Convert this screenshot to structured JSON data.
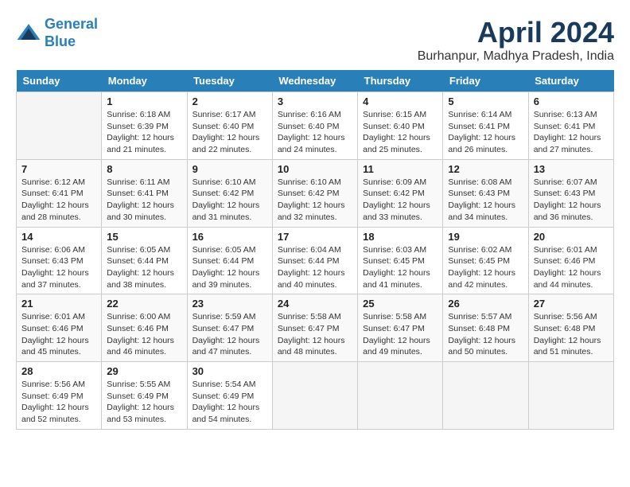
{
  "header": {
    "logo_line1": "General",
    "logo_line2": "Blue",
    "month": "April 2024",
    "location": "Burhanpur, Madhya Pradesh, India"
  },
  "weekdays": [
    "Sunday",
    "Monday",
    "Tuesday",
    "Wednesday",
    "Thursday",
    "Friday",
    "Saturday"
  ],
  "weeks": [
    [
      {
        "day": "",
        "info": ""
      },
      {
        "day": "1",
        "info": "Sunrise: 6:18 AM\nSunset: 6:39 PM\nDaylight: 12 hours\nand 21 minutes."
      },
      {
        "day": "2",
        "info": "Sunrise: 6:17 AM\nSunset: 6:40 PM\nDaylight: 12 hours\nand 22 minutes."
      },
      {
        "day": "3",
        "info": "Sunrise: 6:16 AM\nSunset: 6:40 PM\nDaylight: 12 hours\nand 24 minutes."
      },
      {
        "day": "4",
        "info": "Sunrise: 6:15 AM\nSunset: 6:40 PM\nDaylight: 12 hours\nand 25 minutes."
      },
      {
        "day": "5",
        "info": "Sunrise: 6:14 AM\nSunset: 6:41 PM\nDaylight: 12 hours\nand 26 minutes."
      },
      {
        "day": "6",
        "info": "Sunrise: 6:13 AM\nSunset: 6:41 PM\nDaylight: 12 hours\nand 27 minutes."
      }
    ],
    [
      {
        "day": "7",
        "info": "Sunrise: 6:12 AM\nSunset: 6:41 PM\nDaylight: 12 hours\nand 28 minutes."
      },
      {
        "day": "8",
        "info": "Sunrise: 6:11 AM\nSunset: 6:41 PM\nDaylight: 12 hours\nand 30 minutes."
      },
      {
        "day": "9",
        "info": "Sunrise: 6:10 AM\nSunset: 6:42 PM\nDaylight: 12 hours\nand 31 minutes."
      },
      {
        "day": "10",
        "info": "Sunrise: 6:10 AM\nSunset: 6:42 PM\nDaylight: 12 hours\nand 32 minutes."
      },
      {
        "day": "11",
        "info": "Sunrise: 6:09 AM\nSunset: 6:42 PM\nDaylight: 12 hours\nand 33 minutes."
      },
      {
        "day": "12",
        "info": "Sunrise: 6:08 AM\nSunset: 6:43 PM\nDaylight: 12 hours\nand 34 minutes."
      },
      {
        "day": "13",
        "info": "Sunrise: 6:07 AM\nSunset: 6:43 PM\nDaylight: 12 hours\nand 36 minutes."
      }
    ],
    [
      {
        "day": "14",
        "info": "Sunrise: 6:06 AM\nSunset: 6:43 PM\nDaylight: 12 hours\nand 37 minutes."
      },
      {
        "day": "15",
        "info": "Sunrise: 6:05 AM\nSunset: 6:44 PM\nDaylight: 12 hours\nand 38 minutes."
      },
      {
        "day": "16",
        "info": "Sunrise: 6:05 AM\nSunset: 6:44 PM\nDaylight: 12 hours\nand 39 minutes."
      },
      {
        "day": "17",
        "info": "Sunrise: 6:04 AM\nSunset: 6:44 PM\nDaylight: 12 hours\nand 40 minutes."
      },
      {
        "day": "18",
        "info": "Sunrise: 6:03 AM\nSunset: 6:45 PM\nDaylight: 12 hours\nand 41 minutes."
      },
      {
        "day": "19",
        "info": "Sunrise: 6:02 AM\nSunset: 6:45 PM\nDaylight: 12 hours\nand 42 minutes."
      },
      {
        "day": "20",
        "info": "Sunrise: 6:01 AM\nSunset: 6:46 PM\nDaylight: 12 hours\nand 44 minutes."
      }
    ],
    [
      {
        "day": "21",
        "info": "Sunrise: 6:01 AM\nSunset: 6:46 PM\nDaylight: 12 hours\nand 45 minutes."
      },
      {
        "day": "22",
        "info": "Sunrise: 6:00 AM\nSunset: 6:46 PM\nDaylight: 12 hours\nand 46 minutes."
      },
      {
        "day": "23",
        "info": "Sunrise: 5:59 AM\nSunset: 6:47 PM\nDaylight: 12 hours\nand 47 minutes."
      },
      {
        "day": "24",
        "info": "Sunrise: 5:58 AM\nSunset: 6:47 PM\nDaylight: 12 hours\nand 48 minutes."
      },
      {
        "day": "25",
        "info": "Sunrise: 5:58 AM\nSunset: 6:47 PM\nDaylight: 12 hours\nand 49 minutes."
      },
      {
        "day": "26",
        "info": "Sunrise: 5:57 AM\nSunset: 6:48 PM\nDaylight: 12 hours\nand 50 minutes."
      },
      {
        "day": "27",
        "info": "Sunrise: 5:56 AM\nSunset: 6:48 PM\nDaylight: 12 hours\nand 51 minutes."
      }
    ],
    [
      {
        "day": "28",
        "info": "Sunrise: 5:56 AM\nSunset: 6:49 PM\nDaylight: 12 hours\nand 52 minutes."
      },
      {
        "day": "29",
        "info": "Sunrise: 5:55 AM\nSunset: 6:49 PM\nDaylight: 12 hours\nand 53 minutes."
      },
      {
        "day": "30",
        "info": "Sunrise: 5:54 AM\nSunset: 6:49 PM\nDaylight: 12 hours\nand 54 minutes."
      },
      {
        "day": "",
        "info": ""
      },
      {
        "day": "",
        "info": ""
      },
      {
        "day": "",
        "info": ""
      },
      {
        "day": "",
        "info": ""
      }
    ]
  ]
}
